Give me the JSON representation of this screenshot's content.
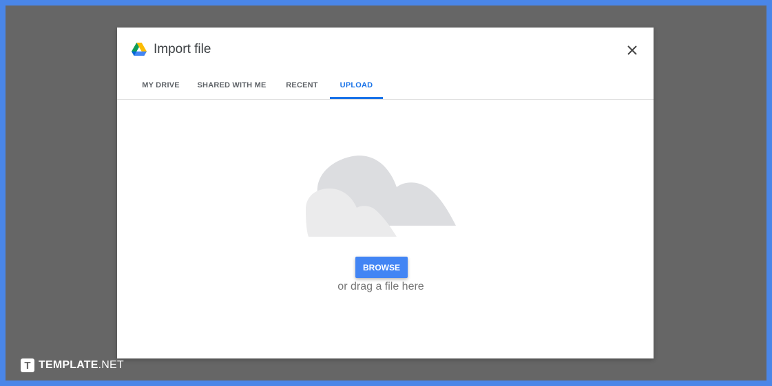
{
  "dialog": {
    "title": "Import file",
    "logo_icon": "google-drive-icon",
    "close_icon": "close-icon",
    "tabs": [
      {
        "label": "MY DRIVE",
        "active": false
      },
      {
        "label": "SHARED WITH ME",
        "active": false
      },
      {
        "label": "RECENT",
        "active": false
      },
      {
        "label": "UPLOAD",
        "active": true
      }
    ],
    "upload": {
      "illustration_icon": "cloud-icon",
      "browse_label": "BROWSE",
      "drag_hint": "or drag a file here"
    }
  },
  "watermark": {
    "mark": "T",
    "name": "TEMPLATE",
    "suffix": ".NET"
  },
  "colors": {
    "accent": "#1a73e8",
    "button": "#4285f4",
    "backdrop": "#666666",
    "frame": "#4a86e8"
  }
}
